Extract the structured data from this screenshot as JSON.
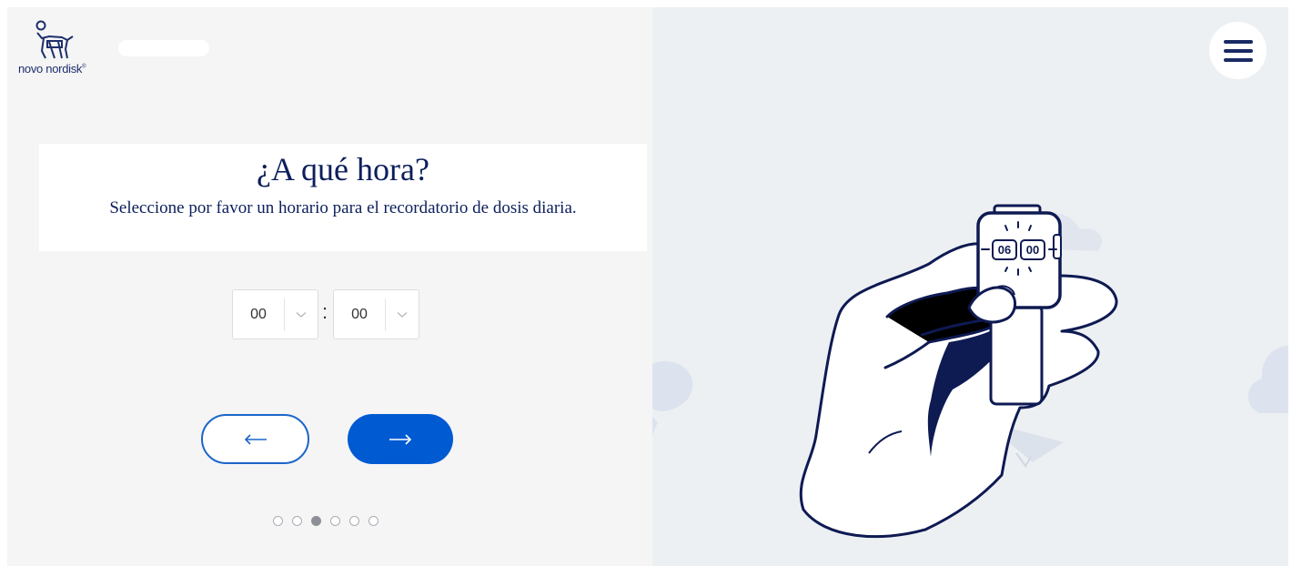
{
  "brand": {
    "name": "novo nordisk",
    "registered": "®"
  },
  "heading": {
    "title": "¿A qué hora?",
    "subtitle": "Seleccione por favor un horario para el recordatorio de dosis diaria."
  },
  "time": {
    "hour": "00",
    "minute": "00",
    "separator": ":"
  },
  "pagination": {
    "count": 6,
    "active_index": 2
  },
  "illustration": {
    "hour": "06",
    "minute": "00"
  },
  "colors": {
    "accent": "#005ad2",
    "navy": "#0c1f5c",
    "left_bg": "#f5f5f6",
    "right_bg": "#edf0f3"
  }
}
